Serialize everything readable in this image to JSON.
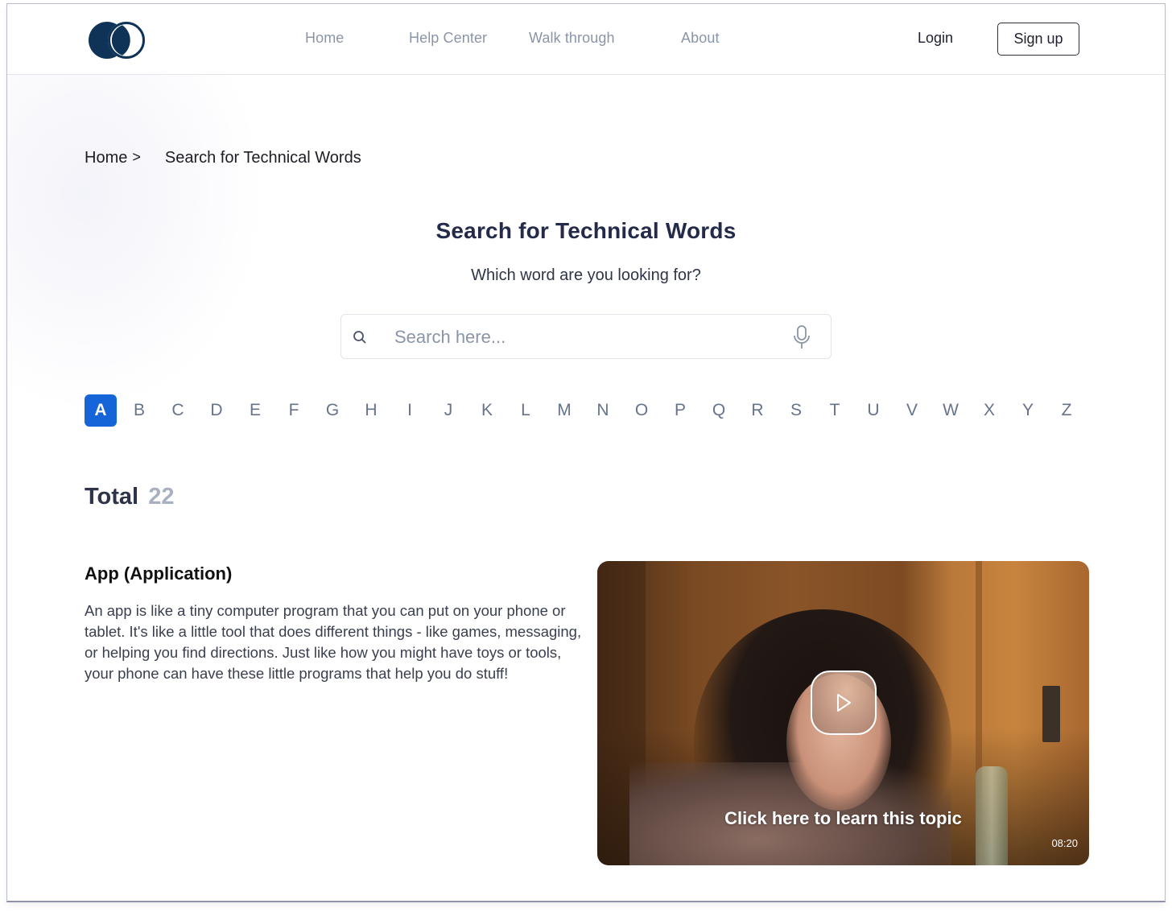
{
  "header": {
    "logo_name": "brand-logo",
    "nav": [
      {
        "label": "Home"
      },
      {
        "label": "Help Center"
      },
      {
        "label": "Walk through"
      },
      {
        "label": "About"
      }
    ],
    "login_label": "Login",
    "signup_label": "Sign up"
  },
  "breadcrumb": {
    "home": "Home",
    "separator": ">",
    "current": "Search for Technical Words"
  },
  "main": {
    "title": "Search for Technical Words",
    "subtitle": "Which word are you looking for?",
    "search": {
      "placeholder": "Search here...",
      "value": ""
    },
    "alphabet": {
      "letters": [
        "A",
        "B",
        "C",
        "D",
        "E",
        "F",
        "G",
        "H",
        "I",
        "J",
        "K",
        "L",
        "M",
        "N",
        "O",
        "P",
        "Q",
        "R",
        "S",
        "T",
        "U",
        "V",
        "W",
        "X",
        "Y",
        "Z"
      ],
      "active": "A"
    },
    "total": {
      "label": "Total",
      "count": "22"
    },
    "entry": {
      "title": "App (Application)",
      "description": "An app is like a tiny computer program that you can put on your phone or tablet. It's like a little tool that does different things - like games, messaging, or helping you find directions. Just like how you might have toys or tools, your phone can have these little programs that help you do stuff!",
      "video": {
        "caption": "Click here to learn this topic",
        "duration": "08:20"
      }
    }
  },
  "colors": {
    "brand_navy": "#0f3357",
    "accent_blue": "#1565d8",
    "title_navy": "#232a4a",
    "nav_gray": "#8b95a7",
    "letter_gray": "#66738a",
    "total_count_gray": "#a9b0bf"
  }
}
